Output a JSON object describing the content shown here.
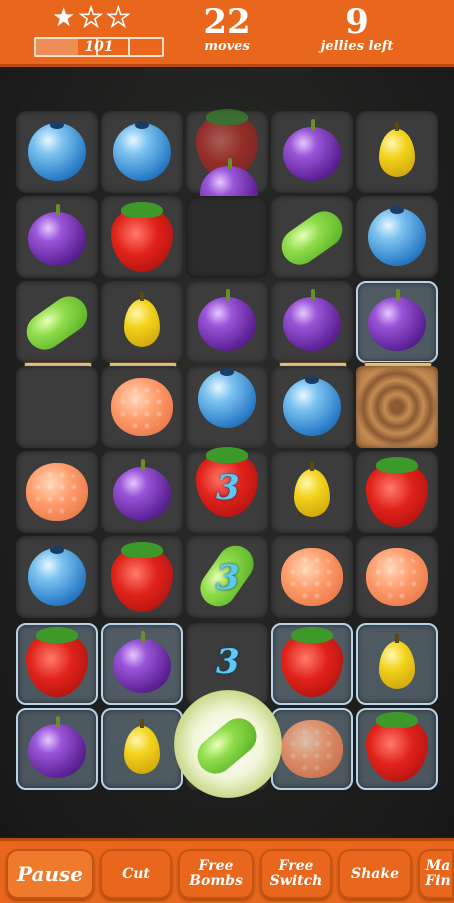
{
  "header": {
    "stars": [
      "filled",
      "empty",
      "empty"
    ],
    "score": "101",
    "score_progress": 0.33,
    "moves_value": "22",
    "moves_label": "moves",
    "jellies_value": "9",
    "jellies_label": "jellies left"
  },
  "board": {
    "counters": [
      "3",
      "3",
      "3"
    ]
  },
  "actions": {
    "pause_label": "Pause",
    "cut_label": "Cut",
    "free_bombs_label": "Free Bombs",
    "free_switch_label": "Free Switch",
    "shake_label": "Shake",
    "partial_label": "Ma Fin"
  },
  "colors": {
    "bar": "#e8671c",
    "counter": "#5cc8f4"
  }
}
